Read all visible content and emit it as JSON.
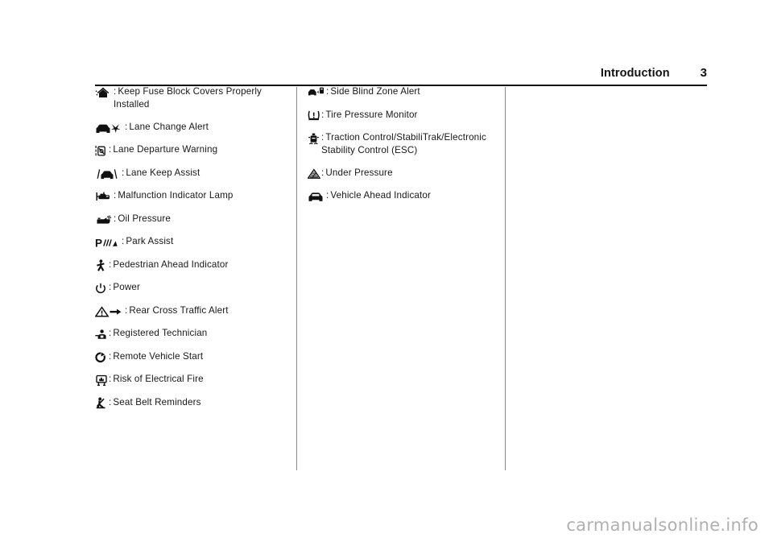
{
  "header": {
    "section_title": "Introduction",
    "page_number": "3"
  },
  "columns": {
    "left": [
      {
        "icon": "fuse-block-cover-icon",
        "colon": ":",
        "label": "Keep Fuse Block Covers Properly Installed"
      },
      {
        "icon": "lane-change-alert-icon",
        "colon": ":",
        "label": "Lane Change Alert"
      },
      {
        "icon": "lane-departure-warning-icon",
        "colon": ":",
        "label": "Lane Departure Warning"
      },
      {
        "icon": "lane-keep-assist-icon",
        "colon": ":",
        "label": "Lane Keep Assist"
      },
      {
        "icon": "malfunction-indicator-lamp-icon",
        "colon": ":",
        "label": "Malfunction Indicator Lamp"
      },
      {
        "icon": "oil-pressure-icon",
        "colon": ":",
        "label": "Oil Pressure"
      },
      {
        "icon": "park-assist-icon",
        "colon": ":",
        "label": "Park Assist"
      },
      {
        "icon": "pedestrian-ahead-indicator-icon",
        "colon": ":",
        "label": "Pedestrian Ahead Indicator"
      },
      {
        "icon": "power-icon",
        "colon": ":",
        "label": "Power"
      },
      {
        "icon": "rear-cross-traffic-alert-icon",
        "colon": ":",
        "label": "Rear Cross Traffic Alert"
      },
      {
        "icon": "registered-technician-icon",
        "colon": ":",
        "label": "Registered Technician"
      },
      {
        "icon": "remote-vehicle-start-icon",
        "colon": ":",
        "label": "Remote Vehicle Start"
      },
      {
        "icon": "risk-of-electrical-fire-icon",
        "colon": ":",
        "label": "Risk of Electrical Fire"
      },
      {
        "icon": "seat-belt-reminders-icon",
        "colon": ":",
        "label": "Seat Belt Reminders"
      }
    ],
    "middle": [
      {
        "icon": "side-blind-zone-alert-icon",
        "colon": ":",
        "label": "Side Blind Zone Alert"
      },
      {
        "icon": "tire-pressure-monitor-icon",
        "colon": ":",
        "label": "Tire Pressure Monitor"
      },
      {
        "icon": "traction-control-icon",
        "colon": ":",
        "label": "Traction Control/StabiliTrak/Electronic Stability Control (ESC)"
      },
      {
        "icon": "under-pressure-icon",
        "colon": ":",
        "label": "Under Pressure"
      },
      {
        "icon": "vehicle-ahead-indicator-icon",
        "colon": ":",
        "label": "Vehicle Ahead Indicator"
      }
    ],
    "right": []
  },
  "watermark": {
    "text": "carmanualsonline.info"
  },
  "colors": {
    "text": "#171717",
    "rule": "#111111",
    "divider": "#8b8b8b",
    "watermark": "#b0b0b0",
    "background": "#ffffff"
  }
}
